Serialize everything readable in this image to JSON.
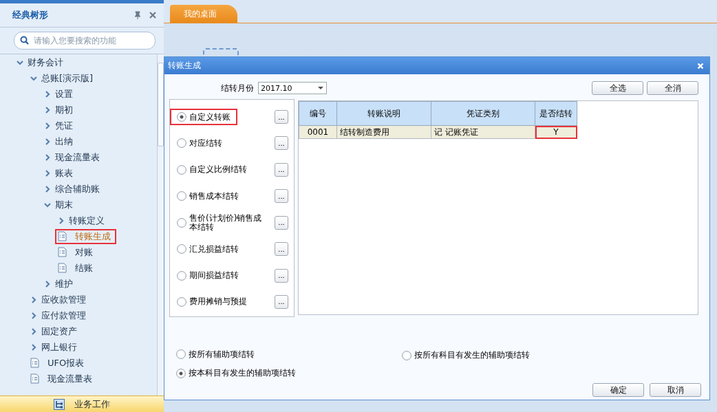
{
  "sidebar": {
    "title": "经典树形",
    "search": {
      "placeholder": "请输入您要搜索的功能"
    },
    "tree": [
      {
        "label": "财务会计",
        "kind": "folder",
        "expanded": true,
        "selected": false,
        "highlighted": false,
        "children": [
          {
            "label": "总账[演示版]",
            "kind": "folder",
            "expanded": true,
            "selected": false,
            "highlighted": false,
            "children": [
              {
                "label": "设置",
                "kind": "folder",
                "expanded": false,
                "selected": false,
                "highlighted": false
              },
              {
                "label": "期初",
                "kind": "folder",
                "expanded": false,
                "selected": false,
                "highlighted": false
              },
              {
                "label": "凭证",
                "kind": "folder",
                "expanded": false,
                "selected": false,
                "highlighted": false
              },
              {
                "label": "出纳",
                "kind": "folder",
                "expanded": false,
                "selected": false,
                "highlighted": false
              },
              {
                "label": "现金流量表",
                "kind": "folder",
                "expanded": false,
                "selected": false,
                "highlighted": false
              },
              {
                "label": "账表",
                "kind": "folder",
                "expanded": false,
                "selected": false,
                "highlighted": false
              },
              {
                "label": "综合辅助账",
                "kind": "folder",
                "expanded": false,
                "selected": false,
                "highlighted": false
              },
              {
                "label": "期末",
                "kind": "folder",
                "expanded": true,
                "selected": false,
                "highlighted": false,
                "children": [
                  {
                    "label": "转账定义",
                    "kind": "folder",
                    "expanded": false,
                    "selected": false,
                    "highlighted": false
                  },
                  {
                    "label": "转账生成",
                    "kind": "doc",
                    "selected": true,
                    "highlighted": true
                  },
                  {
                    "label": "对账",
                    "kind": "doc",
                    "selected": false,
                    "highlighted": false
                  },
                  {
                    "label": "结账",
                    "kind": "doc",
                    "selected": false,
                    "highlighted": false
                  }
                ]
              },
              {
                "label": "维护",
                "kind": "folder",
                "expanded": false,
                "selected": false,
                "highlighted": false
              }
            ]
          },
          {
            "label": "应收款管理",
            "kind": "folder",
            "expanded": false,
            "selected": false,
            "highlighted": false
          },
          {
            "label": "应付款管理",
            "kind": "folder",
            "expanded": false,
            "selected": false,
            "highlighted": false
          },
          {
            "label": "固定资产",
            "kind": "folder",
            "expanded": false,
            "selected": false,
            "highlighted": false
          },
          {
            "label": "网上银行",
            "kind": "folder",
            "expanded": false,
            "selected": false,
            "highlighted": false
          },
          {
            "label": "UFO报表",
            "kind": "doc",
            "selected": false,
            "highlighted": false
          },
          {
            "label": "现金流量表",
            "kind": "doc",
            "selected": false,
            "highlighted": false
          }
        ]
      }
    ],
    "bottom_button": "业务工作"
  },
  "tabs": [
    {
      "label": "我的桌面",
      "selected": true
    }
  ],
  "dialog": {
    "title": "转账生成",
    "month": {
      "label": "结转月份",
      "value": "2017.10"
    },
    "options": [
      {
        "label": "自定义转账",
        "selected": true,
        "highlighted": true,
        "button": "..."
      },
      {
        "label": "对应结转",
        "selected": false,
        "highlighted": false,
        "button": "..."
      },
      {
        "label": "自定义比例结转",
        "selected": false,
        "highlighted": false,
        "button": "..."
      },
      {
        "label": "销售成本结转",
        "selected": false,
        "highlighted": false,
        "button": "..."
      },
      {
        "label": "售价(计划价)销售成本结转",
        "selected": false,
        "highlighted": false,
        "button": "..."
      },
      {
        "label": "汇兑损益结转",
        "selected": false,
        "highlighted": false,
        "button": "..."
      },
      {
        "label": "期间损益结转",
        "selected": false,
        "highlighted": false,
        "button": "..."
      },
      {
        "label": "费用摊销与预提",
        "selected": false,
        "highlighted": false,
        "button": "..."
      }
    ],
    "select_all": "全选",
    "deselect_all": "全消",
    "table": {
      "columns": [
        "编号",
        "转账说明",
        "凭证类别",
        "是否结转"
      ],
      "rows": [
        {
          "cells": [
            {
              "text": "0001",
              "highlighted": false
            },
            {
              "text": "结转制造费用",
              "highlighted": false
            },
            {
              "text": "记 记账凭证",
              "highlighted": false
            },
            {
              "text": "Y",
              "highlighted": true
            }
          ],
          "selected": true
        }
      ]
    },
    "aux_options": [
      {
        "label": "按所有辅助项结转",
        "selected": false
      },
      {
        "label": "按所有科目有发生的辅助项结转",
        "selected": false
      },
      {
        "label": "按本科目有发生的辅助项结转",
        "selected": true
      }
    ],
    "buttons": [
      "确定",
      "取消"
    ]
  }
}
